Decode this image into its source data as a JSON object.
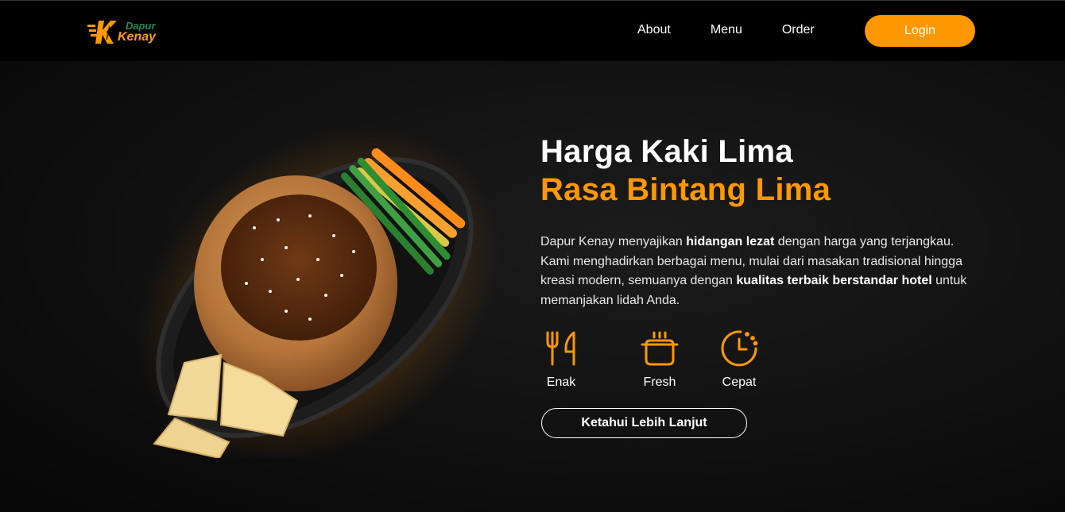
{
  "brand": {
    "name_line1": "Dapur",
    "name_line2": "Kenay",
    "colors": {
      "accent": "#ff9800",
      "brand_green": "#1f8a5b"
    }
  },
  "nav": {
    "links": [
      "About",
      "Menu",
      "Order"
    ],
    "login_label": "Login"
  },
  "hero": {
    "title_line1": "Harga Kaki Lima",
    "title_line2": "Rasa Bintang Lima",
    "description": {
      "part1": "Dapur Kenay menyajikan ",
      "bold1": "hidangan lezat",
      "part2": " dengan harga yang terjangkau. Kami menghadirkan berbagai menu, mulai dari masakan tradisional hingga kreasi modern, semuanya dengan ",
      "bold2": "kualitas terbaik berstandar hotel",
      "part3": " untuk memanjakan lidah Anda."
    },
    "features": [
      {
        "label": "Enak",
        "icon": "fork-knife-icon"
      },
      {
        "label": "Fresh",
        "icon": "cooking-pot-icon"
      },
      {
        "label": "Cepat",
        "icon": "clock-icon"
      }
    ],
    "cta_label": "Ketahui Lebih Lanjut"
  }
}
